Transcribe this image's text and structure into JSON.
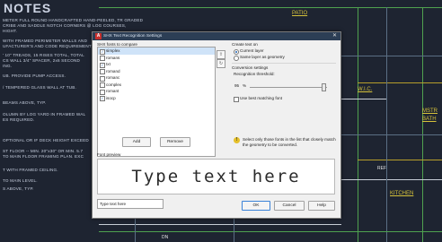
{
  "background_drawing": {
    "title": "NOTES",
    "notes": [
      "METER FULL ROUND HANDCRAFTED HAND-PEELED, TR GRADED",
      "CRIBE AND SADDLE NOTCH CORNERS @ LOG COURSES,",
      "HIGHT.",
      "WITH FRAMED PERIMETER WALLS AND",
      "UFACTURER'S AND CODE REQUIREMENT",
      "' 10\" TREADS, 15 RISES TOTAL, TOTAL",
      "CS WALL 3/4\" SPACER, 2x6 SECOND",
      "ING.",
      "UB. PROVIDE PUMP ACCESS.",
      "/ TEMPERED GLASS WALL AT TUB.",
      "BEAMS ABOVE, TYP.",
      "OLUMN BY LOG YARD IN FRAMED WAL",
      "ES REQUIRED.",
      "OPTIONAL OR IF DECK HEIGHT EXCEED",
      "ST FLOOR -- MIN. 20\"x30\" OR MIN. 5.7",
      "TO MAIN FLOOR FRAMING PLAN. EXC",
      "T WITH FRAMED CEILING.",
      "TO MAIN LEVEL.",
      "S ABOVE, TYP."
    ],
    "labels": {
      "patio": "PATIO",
      "wic": "W.I.C.",
      "mstr": "MSTR",
      "bath": "BATH",
      "kitchen": "KITCHEN",
      "ref": "REF",
      "dn": "DN"
    }
  },
  "dialog": {
    "title": "SHX Text Recognition Settings",
    "close_symbol": "✕",
    "fonts_label": "SHX fonts to compare",
    "fonts": [
      {
        "name": "simplex",
        "checked": true,
        "selected": true
      },
      {
        "name": "romans",
        "checked": false,
        "selected": false
      },
      {
        "name": "txt",
        "checked": true,
        "selected": false
      },
      {
        "name": "romand",
        "checked": false,
        "selected": false
      },
      {
        "name": "romanc",
        "checked": false,
        "selected": false
      },
      {
        "name": "complex",
        "checked": false,
        "selected": false
      },
      {
        "name": "romant",
        "checked": false,
        "selected": false
      },
      {
        "name": "isocp",
        "checked": true,
        "selected": false
      }
    ],
    "add_label": "Add",
    "remove_label": "Remove",
    "create_text_on_label": "Create text on",
    "current_layer_label": "Current layer",
    "same_layer_label": "Same layer as geometry",
    "conversion_settings_label": "Conversion settings",
    "recognition_threshold_label": "Recognition threshold:",
    "threshold_value": "95",
    "threshold_unit": "%",
    "threshold_fraction": 0.95,
    "best_match_label": "Use best matching font",
    "hint_text": "Select only those fonts in the list that closely match the geometry to be converted.",
    "font_preview_label": "Font preview",
    "preview_text": "Type text here",
    "sample_text_value": "Type text here",
    "ok_label": "OK",
    "cancel_label": "Cancel",
    "help_label": "Help"
  }
}
